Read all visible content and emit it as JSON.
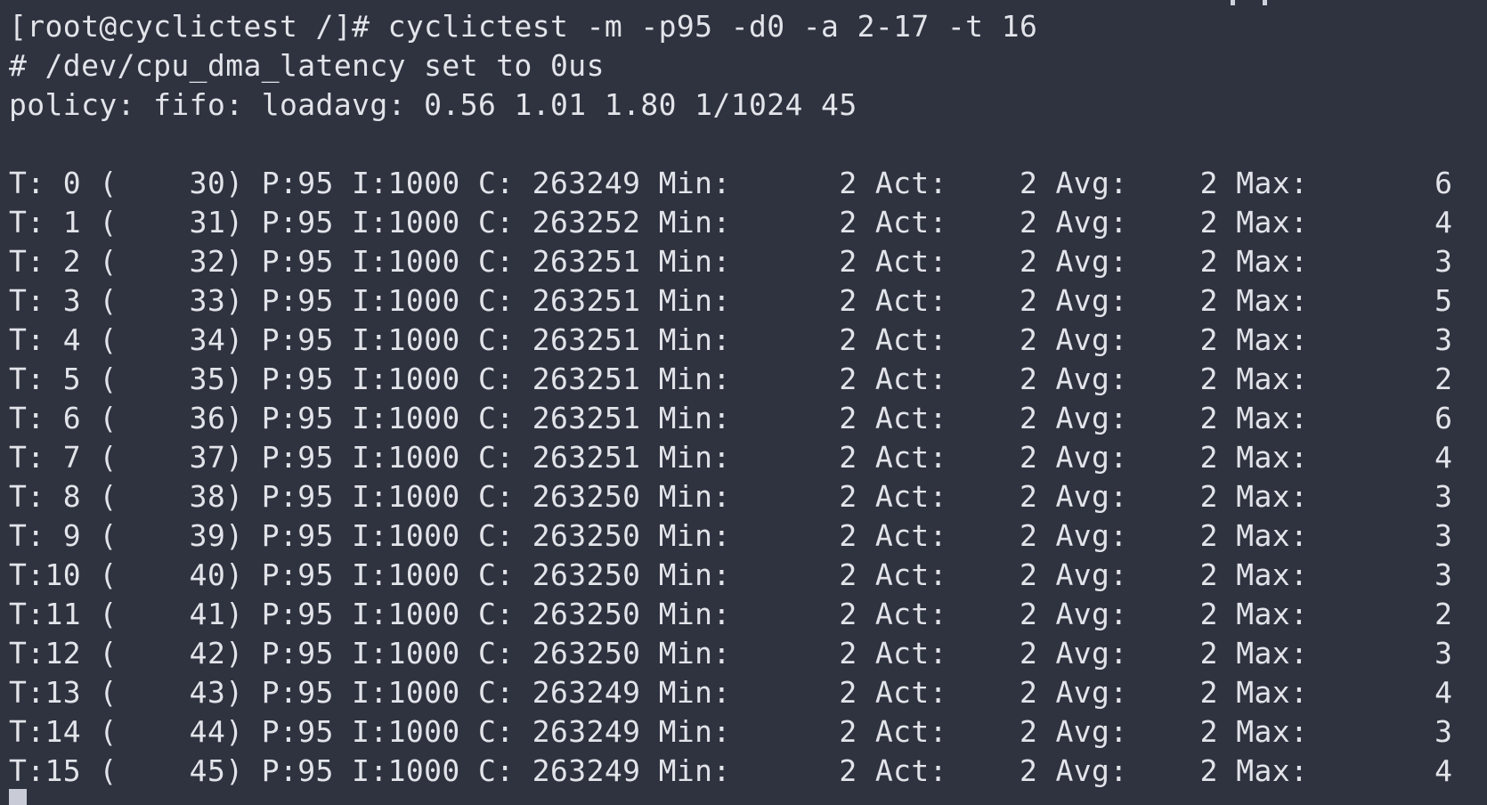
{
  "terminal": {
    "prompt_line": "[root@cyclictest /]# cyclictest -m -p95 -d0 -a 2-17 -t 16",
    "info_lines": [
      "# /dev/cpu_dma_latency set to 0us",
      "policy: fifo: loadavg: 0.56 1.01 1.80 1/1024 45"
    ],
    "threads": [
      {
        "t": "0",
        "tid": "30",
        "p": "95",
        "i": "1000",
        "c": "263249",
        "min": "2",
        "act": "2",
        "avg": "2",
        "max": "6"
      },
      {
        "t": "1",
        "tid": "31",
        "p": "95",
        "i": "1000",
        "c": "263252",
        "min": "2",
        "act": "2",
        "avg": "2",
        "max": "4"
      },
      {
        "t": "2",
        "tid": "32",
        "p": "95",
        "i": "1000",
        "c": "263251",
        "min": "2",
        "act": "2",
        "avg": "2",
        "max": "3"
      },
      {
        "t": "3",
        "tid": "33",
        "p": "95",
        "i": "1000",
        "c": "263251",
        "min": "2",
        "act": "2",
        "avg": "2",
        "max": "5"
      },
      {
        "t": "4",
        "tid": "34",
        "p": "95",
        "i": "1000",
        "c": "263251",
        "min": "2",
        "act": "2",
        "avg": "2",
        "max": "3"
      },
      {
        "t": "5",
        "tid": "35",
        "p": "95",
        "i": "1000",
        "c": "263251",
        "min": "2",
        "act": "2",
        "avg": "2",
        "max": "2"
      },
      {
        "t": "6",
        "tid": "36",
        "p": "95",
        "i": "1000",
        "c": "263251",
        "min": "2",
        "act": "2",
        "avg": "2",
        "max": "6"
      },
      {
        "t": "7",
        "tid": "37",
        "p": "95",
        "i": "1000",
        "c": "263251",
        "min": "2",
        "act": "2",
        "avg": "2",
        "max": "4"
      },
      {
        "t": "8",
        "tid": "38",
        "p": "95",
        "i": "1000",
        "c": "263250",
        "min": "2",
        "act": "2",
        "avg": "2",
        "max": "3"
      },
      {
        "t": "9",
        "tid": "39",
        "p": "95",
        "i": "1000",
        "c": "263250",
        "min": "2",
        "act": "2",
        "avg": "2",
        "max": "3"
      },
      {
        "t": "10",
        "tid": "40",
        "p": "95",
        "i": "1000",
        "c": "263250",
        "min": "2",
        "act": "2",
        "avg": "2",
        "max": "3"
      },
      {
        "t": "11",
        "tid": "41",
        "p": "95",
        "i": "1000",
        "c": "263250",
        "min": "2",
        "act": "2",
        "avg": "2",
        "max": "2"
      },
      {
        "t": "12",
        "tid": "42",
        "p": "95",
        "i": "1000",
        "c": "263250",
        "min": "2",
        "act": "2",
        "avg": "2",
        "max": "3"
      },
      {
        "t": "13",
        "tid": "43",
        "p": "95",
        "i": "1000",
        "c": "263249",
        "min": "2",
        "act": "2",
        "avg": "2",
        "max": "4"
      },
      {
        "t": "14",
        "tid": "44",
        "p": "95",
        "i": "1000",
        "c": "263249",
        "min": "2",
        "act": "2",
        "avg": "2",
        "max": "3"
      },
      {
        "t": "15",
        "tid": "45",
        "p": "95",
        "i": "1000",
        "c": "263249",
        "min": "2",
        "act": "2",
        "avg": "2",
        "max": "4"
      }
    ]
  },
  "colors": {
    "background": "#2f333f",
    "foreground": "#e2e4ea"
  }
}
